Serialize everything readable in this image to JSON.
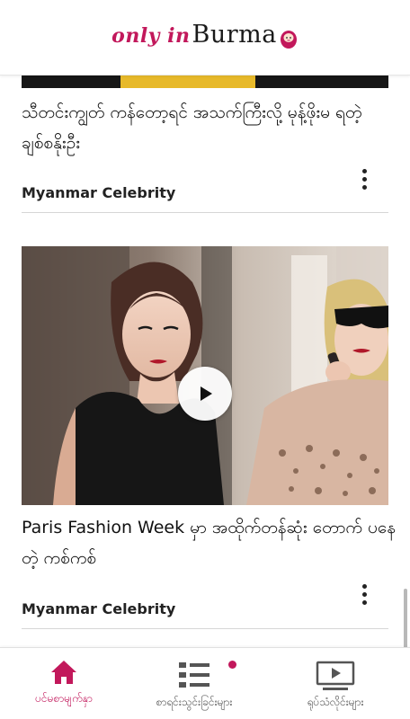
{
  "header": {
    "logo_script": "only in",
    "logo_word": "Burma",
    "brand_color": "#c2185b"
  },
  "articles": [
    {
      "title": "သီတင်းကျွတ် ကန်တော့ရင် အသက်ကြီးလို့ မုန့်ဖိုးမ ရတဲ့ ချစ်စနိုးဦး",
      "source": "Myanmar Celebrity",
      "menu_icon": "more-vert-icon"
    },
    {
      "title": "Paris Fashion Week မှာ အထိုက်တန်ဆုံး တောက် ပနေတဲ့ ကစ်ကစ်",
      "source": "Myanmar Celebrity",
      "menu_icon": "more-vert-icon",
      "media_icon": "play-icon"
    }
  ],
  "bottom_nav": [
    {
      "label": "ပင်မစာမျက်နှာ",
      "icon": "home-icon",
      "active": true
    },
    {
      "label": "စာရင်းသွင်းခြင်းများ",
      "icon": "list-icon",
      "badge": true
    },
    {
      "label": "ရုပ်သံလိုင်းများ",
      "icon": "video-icon"
    }
  ],
  "colors": {
    "accent": "#c2185b",
    "inactive": "#555555"
  }
}
